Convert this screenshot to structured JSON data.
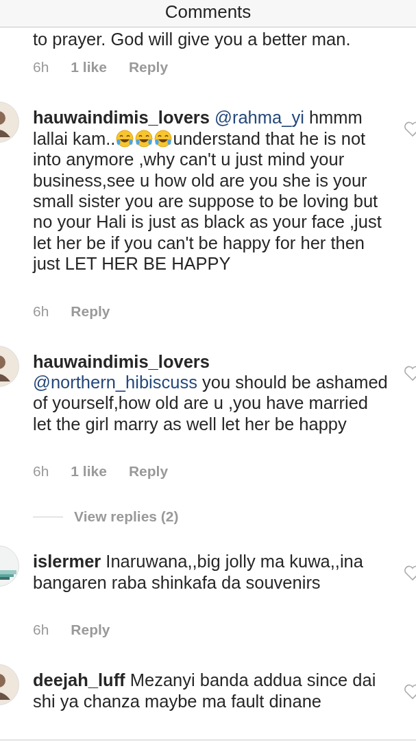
{
  "header": {
    "title": "Comments"
  },
  "partial_comment": {
    "text": "to prayer. God will give you a better man.",
    "time": "6h",
    "likes": "1 like",
    "reply": "Reply"
  },
  "comments": [
    {
      "avatar": {
        "kind": "person"
      },
      "username": "hauwaindimis_lovers",
      "break_after_username": false,
      "parts": [
        {
          "kind": "mention",
          "text": "@rahma_yi"
        },
        {
          "kind": "text",
          "text": " hmmm lallai kam.."
        },
        {
          "kind": "emoji"
        },
        {
          "kind": "emoji"
        },
        {
          "kind": "emoji"
        },
        {
          "kind": "text",
          "text": "understand that he is not into anymore ,why can't u just mind your business,see u how old are you she is your small sister you are suppose to be loving but no your Hali is just as black as your face ,just let her be if you can't be happy for her then just LET HER BE HAPPY"
        }
      ],
      "time": "6h",
      "reply": "Reply"
    },
    {
      "avatar": {
        "kind": "person"
      },
      "username": "hauwaindimis_lovers",
      "break_after_username": true,
      "parts": [
        {
          "kind": "mention",
          "text": "@northern_hibiscuss"
        },
        {
          "kind": "text",
          "text": " you should be ashamed of yourself,how old are u ,you have married let the girl marry as well let her be happy"
        }
      ],
      "time": "6h",
      "likes": "1 like",
      "reply": "Reply",
      "view_replies": "View replies (2)"
    },
    {
      "avatar": {
        "kind": "picture"
      },
      "username": "islermer",
      "break_after_username": false,
      "parts": [
        {
          "kind": "text",
          "text": "Inaruwana,,big jolly ma kuwa,,ina bangaren raba shinkafa da souvenirs"
        }
      ],
      "time": "6h",
      "reply": "Reply"
    },
    {
      "avatar": {
        "kind": "person"
      },
      "username": "deejah_luff",
      "break_after_username": false,
      "parts": [
        {
          "kind": "text",
          "text": "Mezanyi banda addua since dai shi ya chanza maybe ma fault dinane"
        }
      ]
    }
  ]
}
